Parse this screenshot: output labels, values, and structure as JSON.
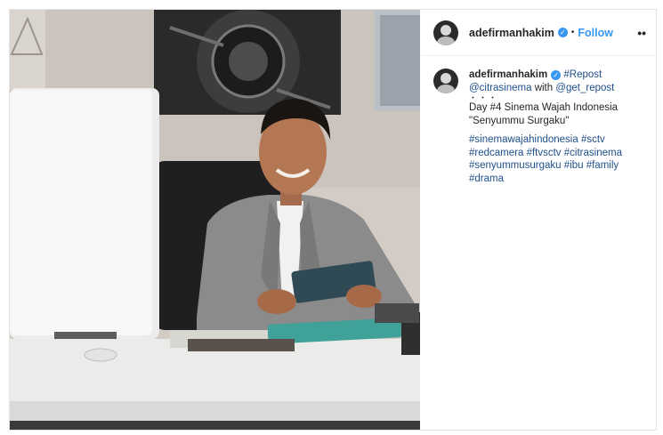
{
  "header": {
    "username": "adefirmanhakim",
    "separator": "•",
    "follow_label": "Follow",
    "more_label": "••"
  },
  "caption": {
    "username": "adefirmanhakim",
    "repost_tag": "#Repost",
    "credit_user": "@citrasinema",
    "with_text": "with",
    "repost_app": "@get_repost",
    "dots": "・・・",
    "line_day": "Day #4 Sinema Wajah Indonesia",
    "line_title": "\"Senyummu Surgaku\"",
    "hashtags": [
      "#sinemawajahindonesia",
      "#sctv",
      "#redcamera",
      "#ftvsctv",
      "#citrasinema",
      "#senyummusurgaku",
      "#ibu",
      "#family",
      "#drama"
    ]
  },
  "icons": {
    "verified": "verified-badge-icon",
    "more": "more-options-icon"
  },
  "colors": {
    "link": "#3897f0",
    "hashtag": "#1e4f8a",
    "verified": "#3897f0"
  }
}
